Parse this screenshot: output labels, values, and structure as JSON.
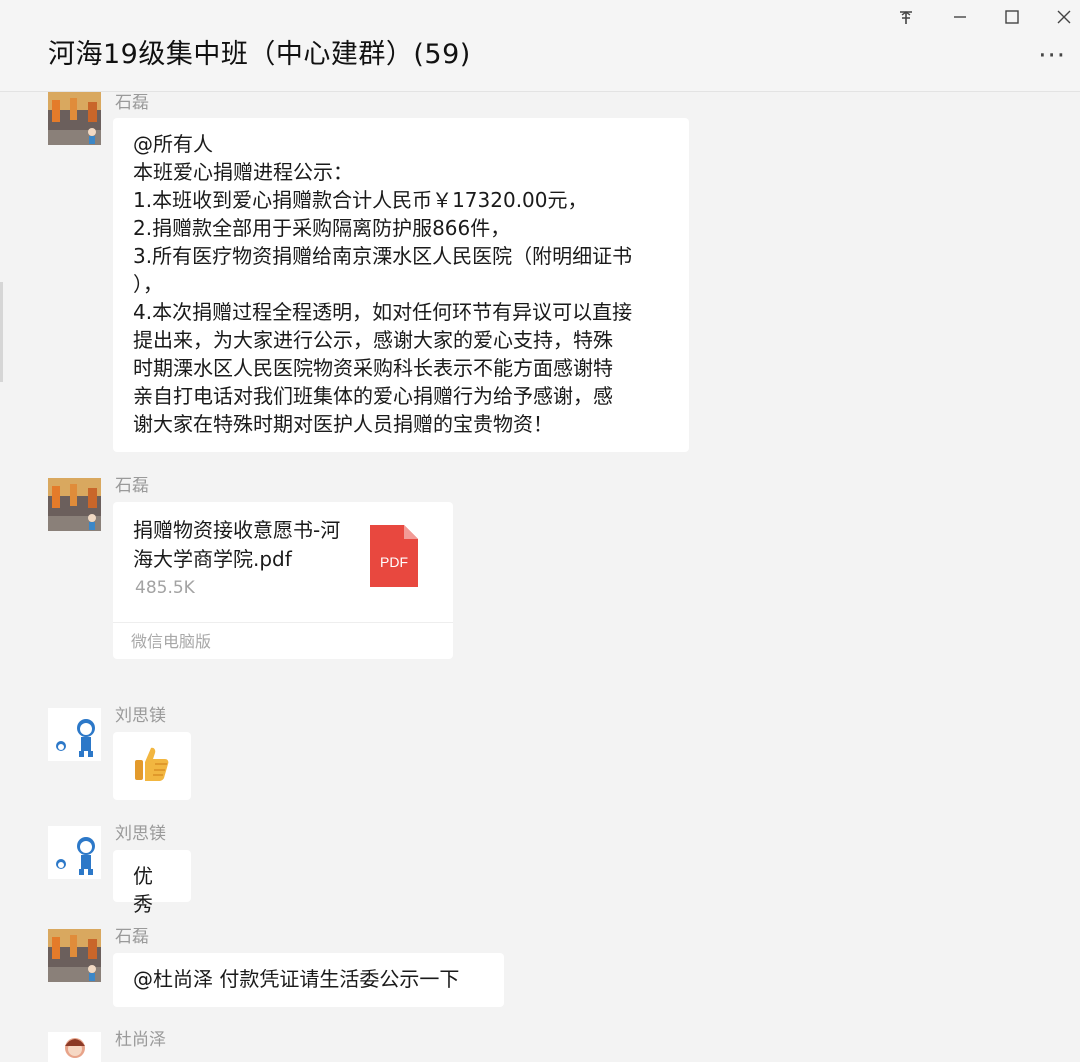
{
  "window": {
    "title": "河海19级集中班（中心建群）(59)",
    "more_label": "···"
  },
  "messages": [
    {
      "sender": "石磊",
      "lines": [
        "@所有人",
        "本班爱心捐赠进程公示：",
        "1.本班收到爱心捐赠款合计人民币￥17320.00元，",
        "2.捐赠款全部用于采购隔离防护服866件，",
        "3.所有医疗物资捐赠给南京溧水区人民医院（附明细证书",
        "），",
        "4.本次捐赠过程全程透明，如对任何环节有异议可以直接",
        "提出来，为大家进行公示，感谢大家的爱心支持，特殊",
        "时期溧水区人民医院物资采购科长表示不能方面感谢特",
        "亲自打电话对我们班集体的爱心捐赠行为给予感谢，感",
        "谢大家在特殊时期对医护人员捐赠的宝贵物资！"
      ]
    },
    {
      "sender": "石磊",
      "file": {
        "name": "捐赠物资接收意愿书-河海大学商学院.pdf",
        "size": "485.5K",
        "type_label": "PDF",
        "source": "微信电脑版"
      }
    },
    {
      "sender": "刘思镁",
      "emoji": "👍"
    },
    {
      "sender": "刘思镁",
      "text": "优秀"
    },
    {
      "sender": "石磊",
      "text": "@杜尚泽 付款凭证请生活委公示一下"
    },
    {
      "sender": "杜尚泽"
    }
  ],
  "colors": {
    "pdf_red": "#e8483f",
    "bubble": "#ffffff",
    "background": "#f3f3f3"
  }
}
